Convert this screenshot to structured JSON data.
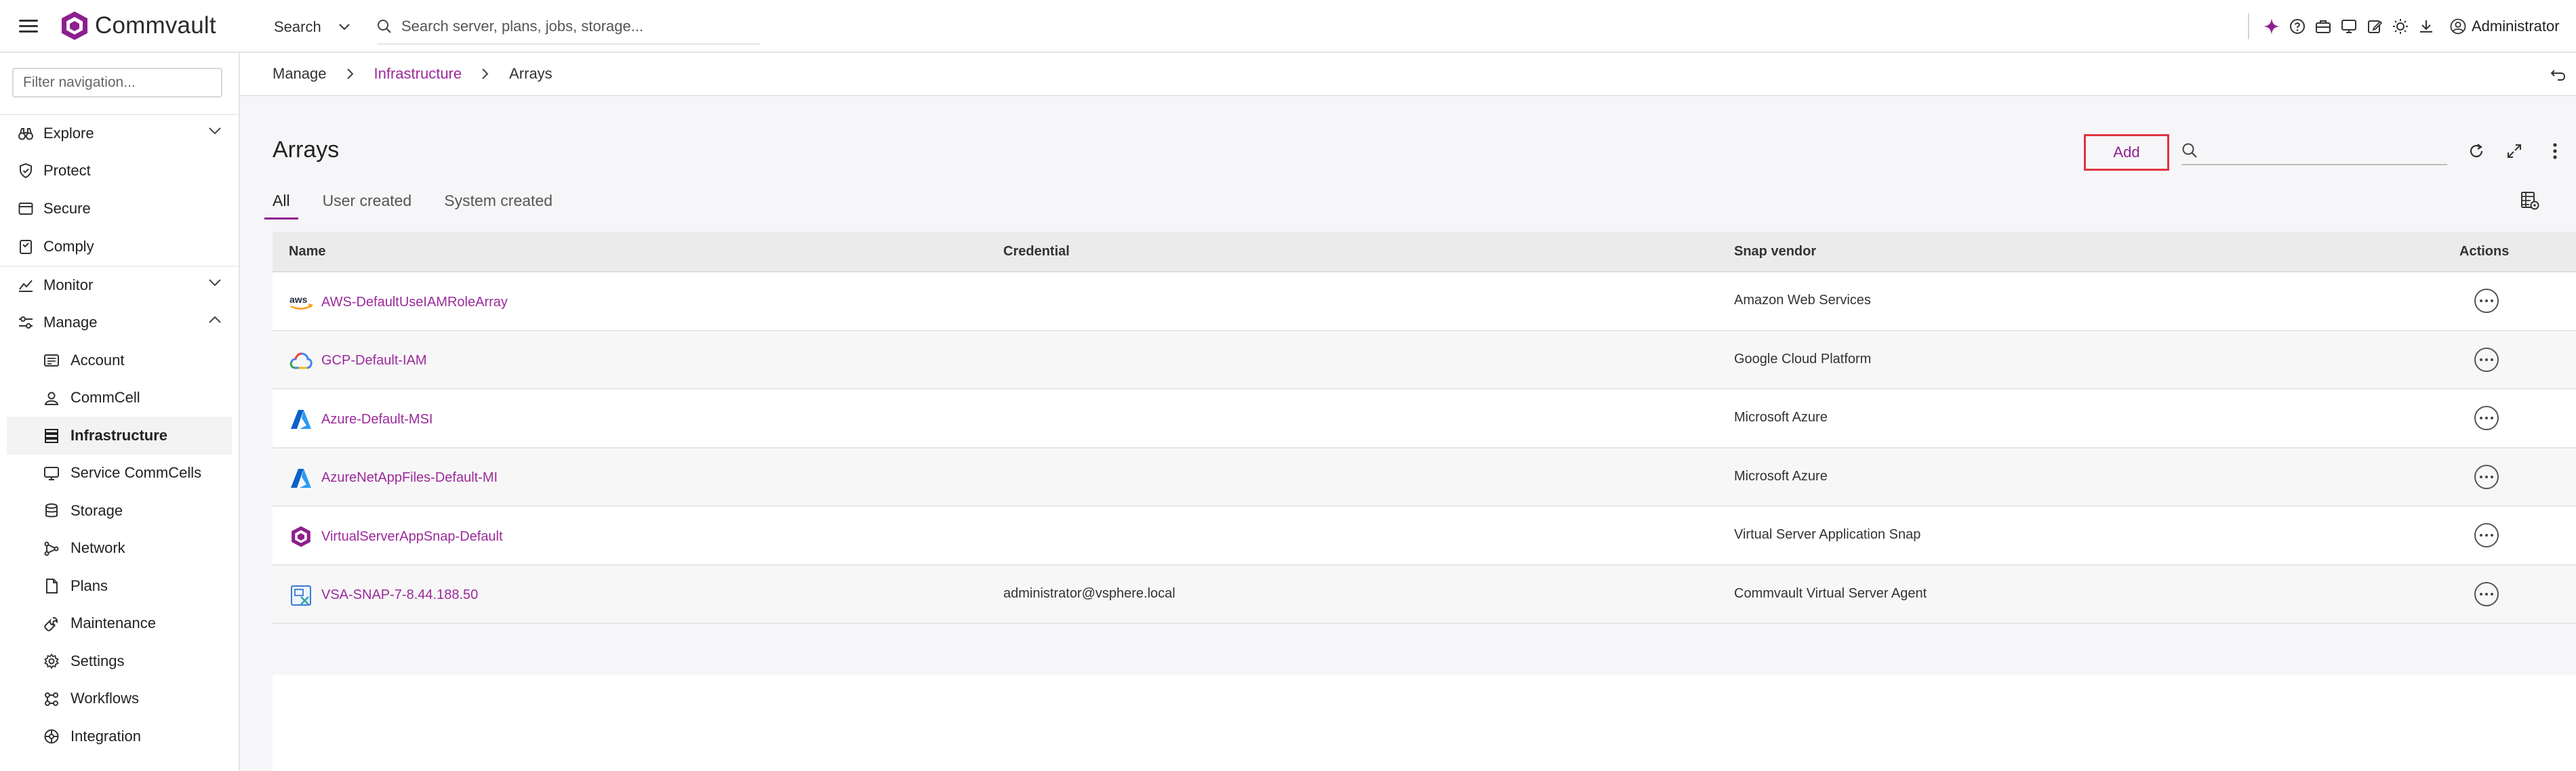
{
  "app": {
    "brand": "Commvault",
    "search_scope": "Search",
    "search_placeholder": "Search server, plans, jobs, storage...",
    "user": "Administrator",
    "accent_color": "#8e1f8e"
  },
  "top_icons": [
    "sparkle-icon",
    "help-icon",
    "briefcase-icon",
    "monitor-icon",
    "edit-icon",
    "theme-icon",
    "download-icon"
  ],
  "sidebar": {
    "filter_placeholder": "Filter navigation...",
    "items": [
      {
        "label": "Explore",
        "icon": "binoculars-icon",
        "expandable": true
      },
      {
        "label": "Protect",
        "icon": "shield-icon"
      },
      {
        "label": "Secure",
        "icon": "lock-icon"
      },
      {
        "label": "Comply",
        "icon": "clipboard-icon"
      },
      {
        "label": "Monitor",
        "icon": "chart-icon",
        "expandable": true
      },
      {
        "label": "Manage",
        "icon": "sliders-icon",
        "expanded": true
      }
    ],
    "manage_items": [
      {
        "label": "Account",
        "icon": "account-icon"
      },
      {
        "label": "CommCell",
        "icon": "commcell-icon"
      },
      {
        "label": "Infrastructure",
        "icon": "infrastructure-icon",
        "active": true
      },
      {
        "label": "Service CommCells",
        "icon": "service-commcells-icon"
      },
      {
        "label": "Storage",
        "icon": "database-icon"
      },
      {
        "label": "Network",
        "icon": "network-icon"
      },
      {
        "label": "Plans",
        "icon": "document-icon"
      },
      {
        "label": "Maintenance",
        "icon": "wrench-icon"
      },
      {
        "label": "Settings",
        "icon": "gear-icon"
      },
      {
        "label": "Workflows",
        "icon": "workflow-icon"
      },
      {
        "label": "Integration",
        "icon": "integration-icon"
      }
    ]
  },
  "breadcrumb": {
    "items": [
      "Manage",
      "Infrastructure",
      "Arrays"
    ]
  },
  "page": {
    "title": "Arrays",
    "add_label": "Add",
    "tabs": [
      {
        "label": "All",
        "active": true
      },
      {
        "label": "User created"
      },
      {
        "label": "System created"
      }
    ]
  },
  "table": {
    "columns": [
      "Name",
      "Credential",
      "Snap vendor",
      "Actions"
    ],
    "rows": [
      {
        "name": "AWS-DefaultUseIAMRoleArray",
        "credential": "",
        "vendor": "Amazon Web Services",
        "icon": "aws-logo-icon"
      },
      {
        "name": "GCP-Default-IAM",
        "credential": "",
        "vendor": "Google Cloud Platform",
        "icon": "gcp-logo-icon"
      },
      {
        "name": "Azure-Default-MSI",
        "credential": "",
        "vendor": "Microsoft Azure",
        "icon": "azure-logo-icon"
      },
      {
        "name": "AzureNetAppFiles-Default-MI",
        "credential": "",
        "vendor": "Microsoft Azure",
        "icon": "azure-logo-icon"
      },
      {
        "name": "VirtualServerAppSnap-Default",
        "credential": "",
        "vendor": "Virtual Server Application Snap",
        "icon": "commvault-logo-icon"
      },
      {
        "name": "VSA-SNAP-7-8.44.188.50",
        "credential": "administrator@vsphere.local",
        "vendor": "Commvault Virtual Server Agent",
        "icon": "vsa-icon"
      }
    ]
  }
}
